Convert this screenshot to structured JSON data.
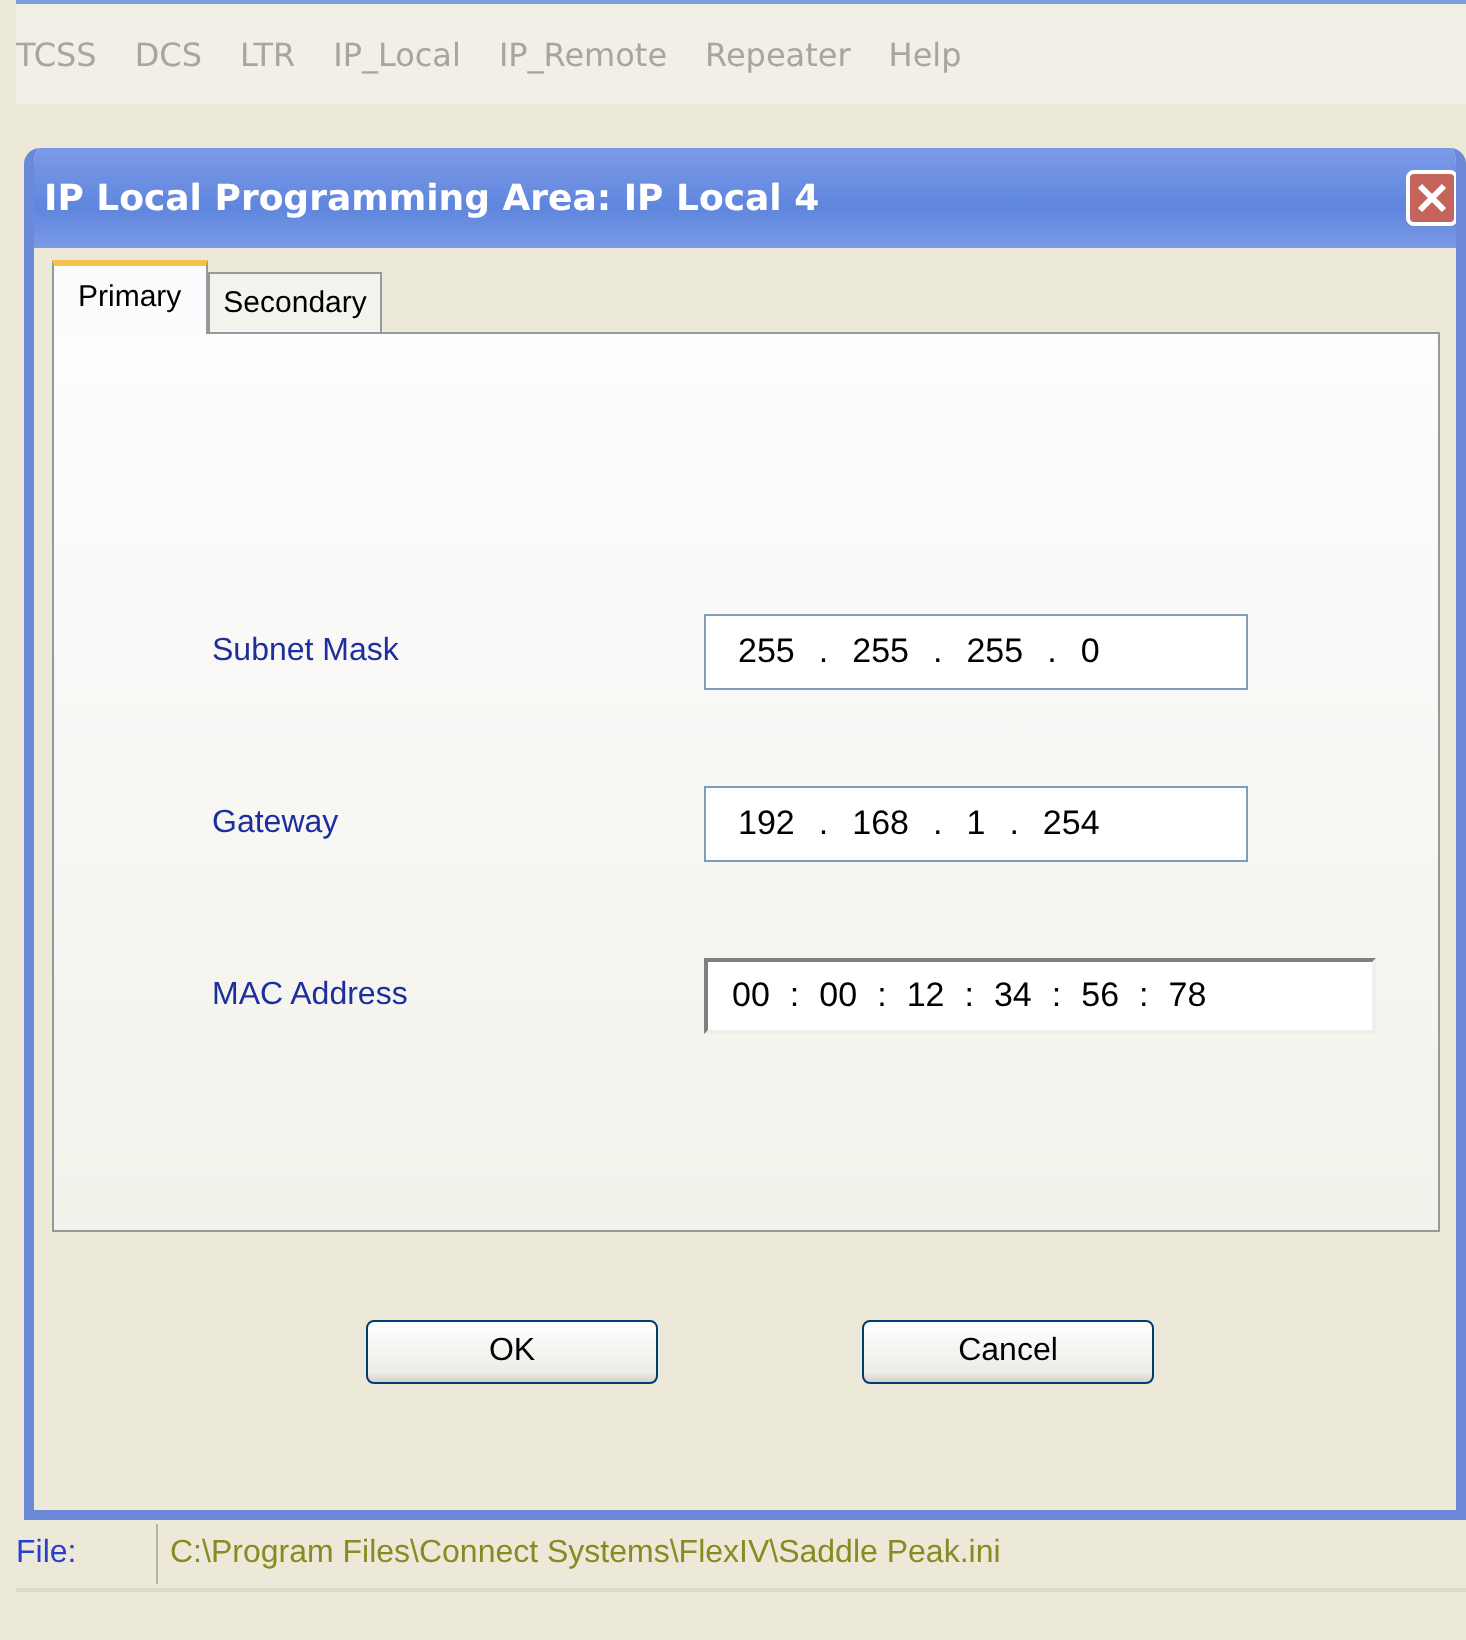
{
  "menu": [
    {
      "label": "TCSS",
      "disabled": true
    },
    {
      "label": "DCS",
      "disabled": true
    },
    {
      "label": "LTR",
      "disabled": true
    },
    {
      "label": "IP_Local",
      "disabled": true
    },
    {
      "label": "IP_Remote",
      "disabled": true
    },
    {
      "label": "Repeater",
      "disabled": true
    },
    {
      "label": "Help",
      "disabled": true
    }
  ],
  "dialog": {
    "title": "IP Local Programming Area:  IP Local 4",
    "tabs": [
      {
        "label": "Primary",
        "selected": true
      },
      {
        "label": "Secondary",
        "selected": false
      }
    ],
    "fields": [
      {
        "label": "Subnet Mask",
        "kind": "ip",
        "separator": ".",
        "parts": [
          "255",
          "255",
          "255",
          "0"
        ]
      },
      {
        "label": "Gateway",
        "kind": "ip",
        "separator": ".",
        "parts": [
          "192",
          "168",
          "1",
          "254"
        ]
      },
      {
        "label": "MAC Address",
        "kind": "mac",
        "separator": ":",
        "parts": [
          "00",
          "00",
          "12",
          "34",
          "56",
          "78"
        ]
      }
    ],
    "buttons": [
      "OK",
      "Cancel"
    ]
  },
  "status": {
    "label": "File:",
    "path": "C:\\Program Files\\Connect Systems\\FlexIV\\Saddle Peak.ini"
  }
}
